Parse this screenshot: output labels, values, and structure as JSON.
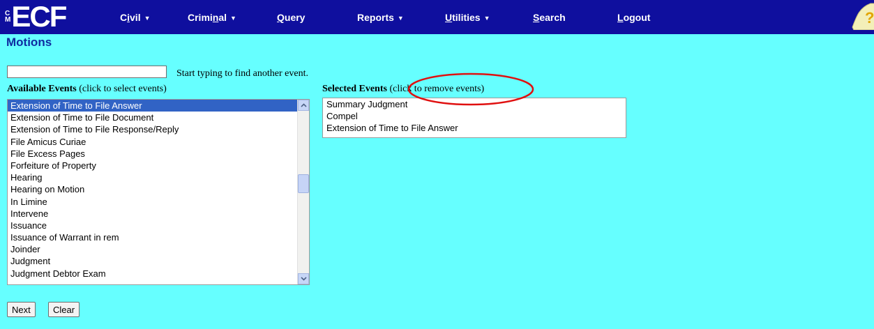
{
  "logo": {
    "small_letters": "CM",
    "text": "ECF"
  },
  "nav": [
    {
      "label": "Civil",
      "underline_index": 1,
      "dropdown": true
    },
    {
      "label": "Criminal",
      "underline_index": 5,
      "dropdown": true
    },
    {
      "label": "Query",
      "underline_index": 0,
      "dropdown": false
    },
    {
      "label": "Reports",
      "underline_index": -1,
      "dropdown": true
    },
    {
      "label": "Utilities",
      "underline_index": 0,
      "dropdown": true
    },
    {
      "label": "Search",
      "underline_index": 0,
      "dropdown": false
    },
    {
      "label": "Logout",
      "underline_index": 0,
      "dropdown": false
    }
  ],
  "page_title": "Motions",
  "search": {
    "value": "",
    "hint": "Start typing to find another event."
  },
  "available": {
    "heading": "Available Events",
    "hint": "(click to select events)",
    "items": [
      "Extension of Time to File Answer",
      "Extension of Time to File Document",
      "Extension of Time to File Response/Reply",
      "File Amicus Curiae",
      "File Excess Pages",
      "Forfeiture of Property",
      "Hearing",
      "Hearing on Motion",
      "In Limine",
      "Intervene",
      "Issuance",
      "Issuance of Warrant in rem",
      "Joinder",
      "Judgment",
      "Judgment Debtor Exam"
    ],
    "selected_index": 0
  },
  "selected": {
    "heading": "Selected Events",
    "hint": "(click to remove events)",
    "items": [
      "Summary Judgment",
      "Compel",
      "Extension of Time to File Answer"
    ]
  },
  "buttons": {
    "next": "Next",
    "clear": "Clear"
  },
  "colors": {
    "background": "#66ffff",
    "nav": "#0f0f9e",
    "title": "#0f2ca0",
    "selection": "#3163c5",
    "annotation": "#e01010"
  }
}
